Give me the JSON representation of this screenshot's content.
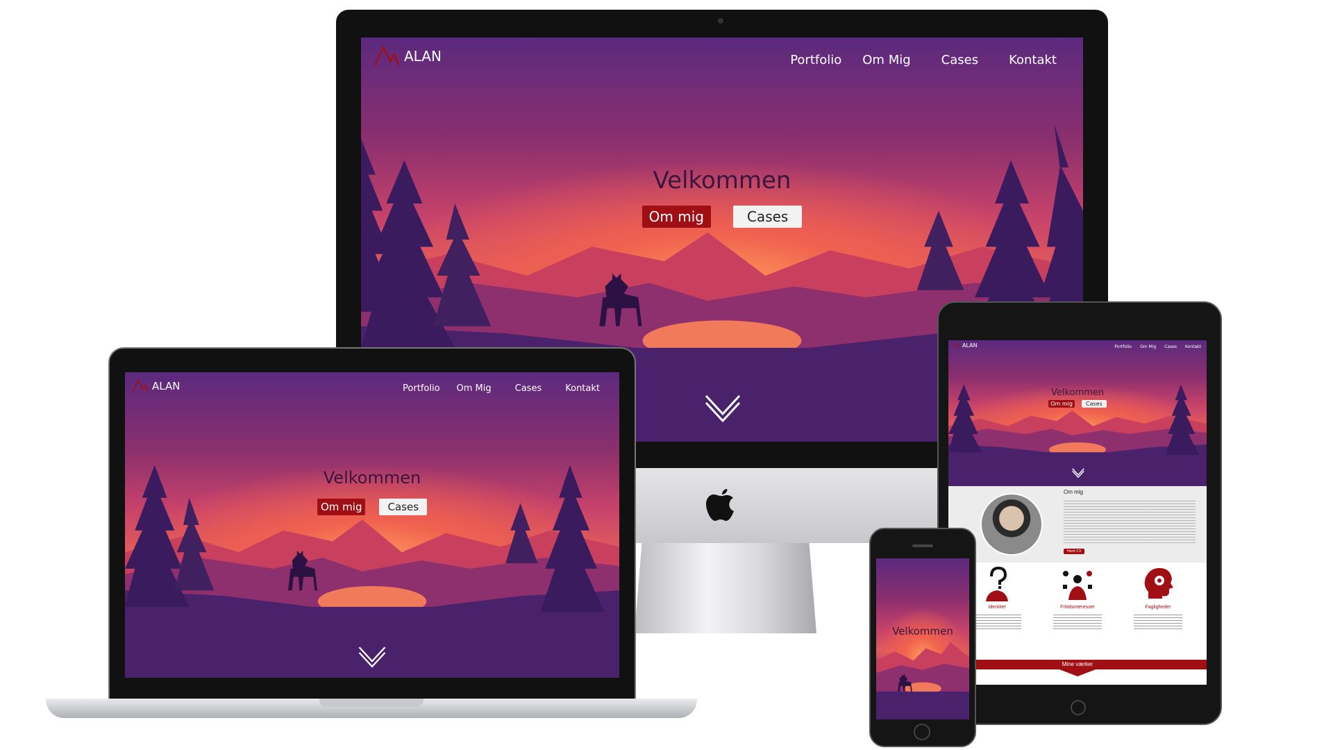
{
  "site": {
    "logo_text": "ALAN",
    "nav": [
      "Portfolio",
      "Om Mig",
      "Cases",
      "Kontakt"
    ],
    "hero_title": "Velkommen",
    "btn_primary": "Om mig",
    "btn_secondary": "Cases"
  },
  "tablet": {
    "about_heading": "Om mig",
    "cv_button": "Hent CV",
    "features": [
      {
        "label": "Identitet",
        "icon": "question-person-icon"
      },
      {
        "label": "Fritidsinteresser",
        "icon": "hobbies-icon"
      },
      {
        "label": "Fagligheder",
        "icon": "head-gear-icon"
      }
    ],
    "works_banner": "Mine værker"
  },
  "colors": {
    "accent_red": "#a00f14",
    "hero_purple": "#45206a",
    "hero_orange": "#f0614f"
  }
}
